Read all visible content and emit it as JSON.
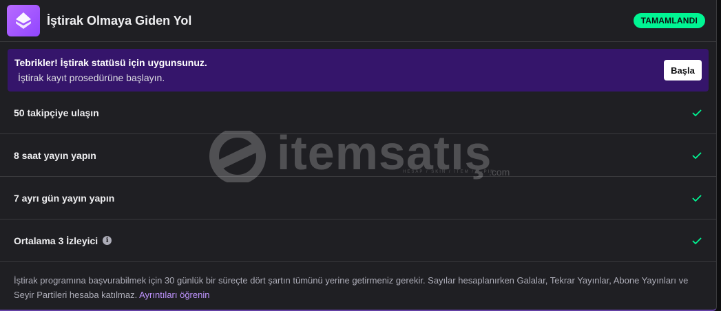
{
  "header": {
    "title": "İştirak Olmaya Giden Yol",
    "status_badge": "TAMAMLANDI"
  },
  "banner": {
    "title": "Tebrikler! İştirak statüsü için uygunsunuz.",
    "subtitle": "İştirak kayıt prosedürüne başlayın.",
    "button_label": "Başla"
  },
  "requirements": [
    {
      "label": "50 takipçiye ulaşın",
      "completed": true
    },
    {
      "label": "8 saat yayın yapın",
      "completed": true
    },
    {
      "label": "7 ayrı gün yayın yapın",
      "completed": true
    },
    {
      "label": "Ortalama 3 İzleyici",
      "completed": true,
      "has_info": true
    }
  ],
  "footer": {
    "text": "İştirak programına başvurabilmek için 30 günlük bir süreçte dört şartın tümünü yerine getirmeniz gerekir. Sayılar hesaplanırken Galalar, Tekrar Yayınlar, Abone Yayınları ve Seyir Partileri hesaba katılmaz.",
    "link_label": "Ayrıntıları öğrenin"
  },
  "watermark": {
    "brand": "itemsatış",
    "tagline": "HESAP / SKIN / ITEM / E-PIN",
    "domain": ".com"
  },
  "colors": {
    "background": "#1f1f23",
    "banner": "#35156b",
    "accent_purple": "#9146ff",
    "success_green": "#00f593",
    "link": "#bf94ff"
  },
  "icons": {
    "logo": "affiliate-badge-icon",
    "check": "checkmark-icon",
    "info": "info-icon"
  }
}
